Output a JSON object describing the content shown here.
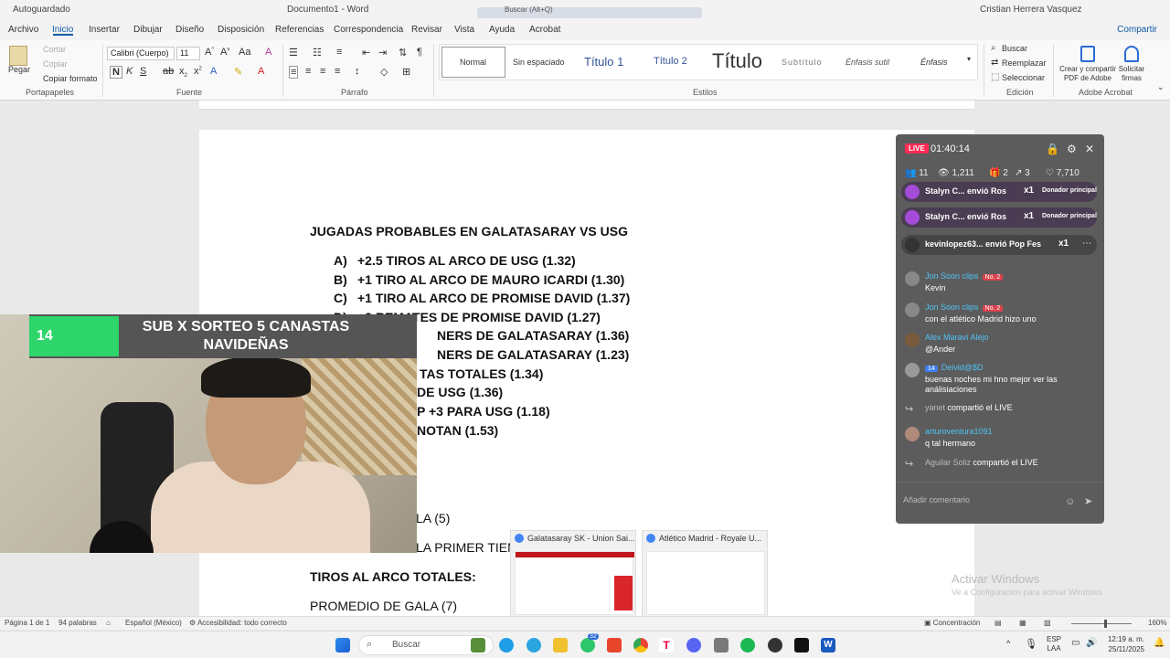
{
  "titlebar": {
    "autosave": "Autoguardado",
    "doc_title": "Documento1 - Word",
    "search_placeholder": "Buscar (Alt+Q)",
    "user": "Cristian Herrera Vasquez"
  },
  "tabs": [
    "Archivo",
    "Inicio",
    "Insertar",
    "Dibujar",
    "Diseño",
    "Disposición",
    "Referencias",
    "Correspondencia",
    "Revisar",
    "Vista",
    "Ayuda",
    "Acrobat"
  ],
  "share_label": "Compartir",
  "ribbon": {
    "clipboard": {
      "paste": "Pegar",
      "cut": "Cortar",
      "copy": "Copiar",
      "format_painter": "Copiar formato",
      "label": "Portapapeles"
    },
    "font": {
      "name": "Calibri (Cuerpo)",
      "size": "11",
      "label": "Fuente"
    },
    "paragraph": {
      "label": "Párrafo"
    },
    "styles": {
      "items": [
        "Normal",
        "Sin espaciado",
        "Título 1",
        "Título 2",
        "Título",
        "Subtítulo",
        "Énfasis sutil",
        "Énfasis"
      ],
      "label": "Estilos"
    },
    "editing": {
      "find": "Buscar",
      "replace": "Reemplazar",
      "select": "Seleccionar",
      "label": "Edición"
    },
    "acrobat": {
      "create": "Crear y compartir PDF de Adobe",
      "request": "Solicitar firmas",
      "label": "Adobe Acrobat"
    }
  },
  "document": {
    "heading": "JUGADAS PROBABLES EN GALATASARAY VS USG",
    "items": [
      {
        "letter": "A)",
        "text": "+2.5 TIROS AL ARCO DE USG (1.32)"
      },
      {
        "letter": "B)",
        "text": "+1 TIRO AL ARCO DE MAURO ICARDI (1.30)"
      },
      {
        "letter": "C)",
        "text": "+1 TIRO AL ARCO DE PROMISE DAVID (1.37)"
      },
      {
        "letter": "D)",
        "text": "+2 REMATES DE PROMISE DAVID (1.27)"
      }
    ],
    "partials": [
      "NERS DE GALATASARAY (1.36)",
      "NERS DE GALATASARAY (1.23)",
      "TAS TOTALES (1.34)",
      "DE USG (1.36)",
      "P +3 PARA USG (1.18)",
      "NOTAN (1.53)",
      "LA (5)",
      "LA PRIMER TIEM"
    ],
    "section": "TIROS AL ARCO TOTALES:",
    "promedio": "PROMEDIO DE GALA (7)"
  },
  "overlay": {
    "badge": "14",
    "banner": "SUB X SORTEO 5 CANASTAS NAVIDEÑAS"
  },
  "live": {
    "badge": "LIVE",
    "time": "01:40:14",
    "stats": {
      "people": "11",
      "viewers": "1,211",
      "gifts": "2",
      "shares": "3",
      "likes": "7,710"
    },
    "gifts": [
      {
        "user": "Stalyn C... envió Ros",
        "count": "x1",
        "tag": "Donador principal"
      },
      {
        "user": "Stalyn C... envió Ros",
        "count": "x1",
        "tag": "Donador principal"
      },
      {
        "user": "kevinlopez63... envió Pop Fes",
        "count": "x1",
        "tag": ""
      }
    ],
    "messages": [
      {
        "user": "Jon Soon clips",
        "tag": "No. 2",
        "lvl": "",
        "text": "Kevin"
      },
      {
        "user": "Jon Soon clips",
        "tag": "No. 2",
        "lvl": "",
        "text": "con el atlético Madrid hizo uno"
      },
      {
        "user": "Alex Maraví Alejo",
        "tag": "",
        "lvl": "",
        "text": "@Ander"
      },
      {
        "user": "Deivid@$D",
        "tag": "",
        "lvl": "14",
        "text": "buenas noches mi hno mejor ver las"
      },
      {
        "user": "",
        "tag": "",
        "lvl": "",
        "text": "análisiaciones"
      },
      {
        "user": "yanet",
        "tag": "",
        "lvl": "",
        "text": "compartió el LIVE"
      },
      {
        "user": "arturoventura1091",
        "tag": "",
        "lvl": "",
        "text": "q tal hermano"
      },
      {
        "user": "Aguilar Soliz",
        "tag": "",
        "lvl": "",
        "text": "compartió el LIVE"
      }
    ],
    "comment_placeholder": "Añadir comentario"
  },
  "thumbnails": [
    {
      "title": "Galatasaray SK - Union Sai..."
    },
    {
      "title": "Atlético Madrid - Royale U..."
    }
  ],
  "watermark": {
    "line1": "Activar Windows",
    "line2": "Ve a Configuración para activar Windows."
  },
  "statusbar": {
    "page": "Página 1 de 1",
    "words": "94 palabras",
    "lang": "Español (México)",
    "access": "Accesibilidad: todo correcto",
    "focus": "Concentración",
    "zoom": "160%"
  },
  "taskbar": {
    "search": "Buscar",
    "badge": "32",
    "lang1": "ESP",
    "lang2": "LAA",
    "time": "12:19 a. m.",
    "date": "25/11/2025"
  },
  "colors": {
    "word_blue": "#0f5aa6",
    "live_red": "#ff2b55",
    "sub_green": "#2ed56a"
  }
}
